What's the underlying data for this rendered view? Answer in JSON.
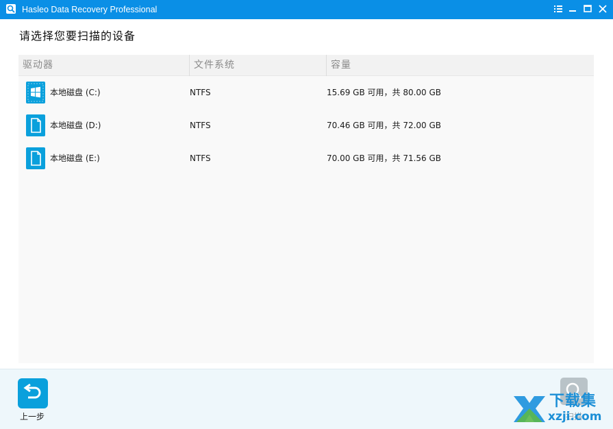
{
  "window": {
    "title": "Hasleo Data Recovery Professional",
    "icons": {
      "app": "magnifier-disk-icon",
      "menu": "menu-list-icon",
      "minimize": "minimize-icon",
      "maximize": "maximize-icon",
      "close": "close-icon"
    }
  },
  "page": {
    "title": "请选择您要扫描的设备"
  },
  "table": {
    "columns": [
      "驱动器",
      "文件系统",
      "容量"
    ],
    "rows": [
      {
        "icon": "windows-drive-icon",
        "drive": "本地磁盘 (C:)",
        "fs": "NTFS",
        "capacity": "15.69 GB 可用，共 80.00 GB"
      },
      {
        "icon": "document-drive-icon",
        "drive": "本地磁盘 (D:)",
        "fs": "NTFS",
        "capacity": "70.46 GB 可用，共 72.00 GB"
      },
      {
        "icon": "document-drive-icon",
        "drive": "本地磁盘 (E:)",
        "fs": "NTFS",
        "capacity": "70.00 GB 可用，共 71.56 GB"
      }
    ]
  },
  "footer": {
    "back_label": "上一步",
    "back_icon": "return-arrow-icon",
    "scan_label": "扫描",
    "scan_icon": "scan-magnifier-icon"
  },
  "watermark": {
    "top": "下载集",
    "bottom": "xzji.com"
  },
  "colors": {
    "titlebar": "#0a8fe6",
    "accent": "#0aa0dc",
    "panel": "#f9f9f9",
    "footer": "#eef7fb"
  }
}
